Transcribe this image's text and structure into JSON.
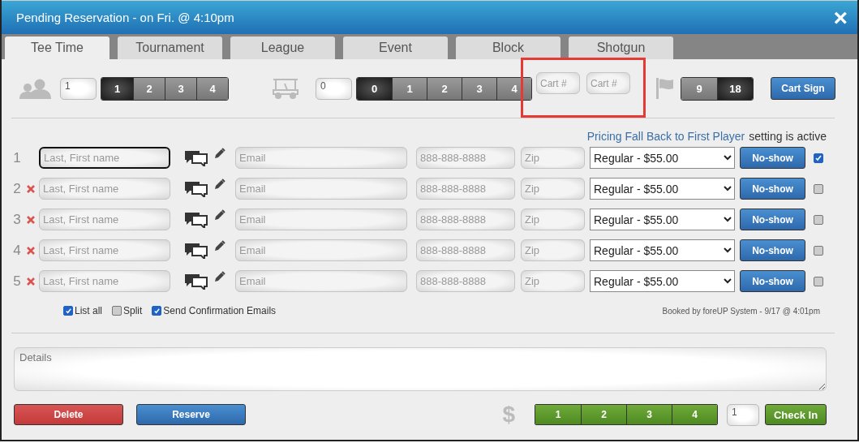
{
  "window": {
    "title": "Pending Reservation - on Fri. @ 4:10pm",
    "close": "×"
  },
  "tabs": [
    {
      "label": "Tee Time",
      "selected": true
    },
    {
      "label": "Tournament",
      "selected": false
    },
    {
      "label": "League",
      "selected": false
    },
    {
      "label": "Event",
      "selected": false
    },
    {
      "label": "Block",
      "selected": false
    },
    {
      "label": "Shotgun",
      "selected": false
    }
  ],
  "players": {
    "value": "1",
    "options": [
      {
        "label": "1",
        "selected": true
      },
      {
        "label": "2",
        "selected": false
      },
      {
        "label": "3",
        "selected": false
      },
      {
        "label": "4",
        "selected": false
      }
    ]
  },
  "carts": {
    "value": "0",
    "options": [
      {
        "label": "0",
        "selected": true
      },
      {
        "label": "1",
        "selected": false
      },
      {
        "label": "2",
        "selected": false
      },
      {
        "label": "3",
        "selected": false
      },
      {
        "label": "4",
        "selected": false
      }
    ]
  },
  "cart_numbers": {
    "highlighted": true,
    "fields": [
      {
        "placeholder": "Cart #"
      },
      {
        "placeholder": "Cart #"
      }
    ]
  },
  "holes": {
    "options": [
      {
        "label": "9",
        "selected": false
      },
      {
        "label": "18",
        "selected": true
      }
    ]
  },
  "cart_sign_button": "Cart Sign",
  "pricing_notice": {
    "link": "Pricing Fall Back to First Player",
    "text": "setting is active"
  },
  "guests": [
    {
      "number": "1",
      "removable": false,
      "focused": true,
      "name_placeholder": "Last, First name",
      "email_placeholder": "Email",
      "phone_placeholder": "888-888-8888",
      "zip_placeholder": "Zip",
      "rate": "Regular - $55.00",
      "no_show": "No-show",
      "checked": true
    },
    {
      "number": "2",
      "removable": true,
      "focused": false,
      "name_placeholder": "Last, First name",
      "email_placeholder": "Email",
      "phone_placeholder": "888-888-8888",
      "zip_placeholder": "Zip",
      "rate": "Regular - $55.00",
      "no_show": "No-show",
      "checked": false
    },
    {
      "number": "3",
      "removable": true,
      "focused": false,
      "name_placeholder": "Last, First name",
      "email_placeholder": "Email",
      "phone_placeholder": "888-888-8888",
      "zip_placeholder": "Zip",
      "rate": "Regular - $55.00",
      "no_show": "No-show",
      "checked": false
    },
    {
      "number": "4",
      "removable": true,
      "focused": false,
      "name_placeholder": "Last, First name",
      "email_placeholder": "Email",
      "phone_placeholder": "888-888-8888",
      "zip_placeholder": "Zip",
      "rate": "Regular - $55.00",
      "no_show": "No-show",
      "checked": false
    },
    {
      "number": "5",
      "removable": true,
      "focused": false,
      "name_placeholder": "Last, First name",
      "email_placeholder": "Email",
      "phone_placeholder": "888-888-8888",
      "zip_placeholder": "Zip",
      "rate": "Regular - $55.00",
      "no_show": "No-show",
      "checked": false
    }
  ],
  "options": [
    {
      "label": "List all",
      "checked": true
    },
    {
      "label": "Split",
      "checked": false
    },
    {
      "label": "Send Confirmation Emails",
      "checked": true
    }
  ],
  "booked_by": "Booked by foreUP System - 9/17 @ 4:01pm",
  "details": {
    "placeholder": "Details"
  },
  "footer": {
    "delete": "Delete",
    "reserve": "Reserve",
    "currency": "$",
    "pay_options": [
      {
        "label": "1"
      },
      {
        "label": "2"
      },
      {
        "label": "3"
      },
      {
        "label": "4"
      }
    ],
    "quantity": "1",
    "check_in": "Check In"
  }
}
